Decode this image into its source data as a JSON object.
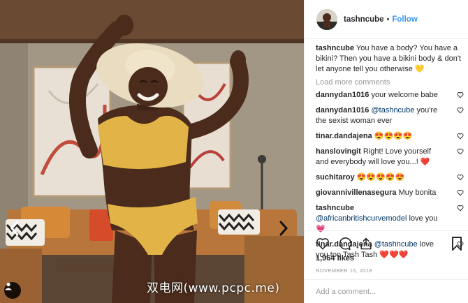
{
  "post": {
    "image_alt": "Woman in a yellow bikini and straw hat dancing in a living room",
    "watermark": "双电网(www.pcpc.me)",
    "icons": {
      "prev": "chevron-left-icon",
      "next": "chevron-right-icon",
      "tag": "user-tag-icon"
    }
  },
  "header": {
    "username": "tashncube",
    "dot": "•",
    "follow_label": "Follow"
  },
  "caption": {
    "username": "tashncube",
    "text": "You have a body? You have a bikini? Then you have a bikini body & don't let anyone tell you otherwise 💛"
  },
  "load_more": "Load more comments",
  "comments": [
    {
      "user": "dannydan1016",
      "text": "your welcome babe",
      "mention": ""
    },
    {
      "user": "dannydan1016",
      "mention": "@tashncube",
      "text": "you're the sexist woman ever"
    },
    {
      "user": "tinar.dandajena",
      "text": "😍😍😍😍",
      "mention": ""
    },
    {
      "user": "hanslovingit",
      "text": "Right! Love yourself and everybody will love you...! ❤️",
      "mention": ""
    },
    {
      "user": "suchitaroy",
      "text": "😍😍😍😍😍",
      "mention": ""
    },
    {
      "user": "giovannivillenasegura",
      "text": "Muy bonita",
      "mention": ""
    },
    {
      "user": "tashncube",
      "mention": "@africanbritishcurvemodel",
      "text": "love you 💗"
    },
    {
      "user": "tinar.dandajena",
      "mention": "@tashncube",
      "text": "love you too Tash Tash ❤️❤️❤️"
    }
  ],
  "actions": {
    "likes": "1,964 likes",
    "date": "NOVEMBER 15, 2018",
    "icons": [
      "heart-icon",
      "comment-icon",
      "share-icon",
      "bookmark-icon"
    ]
  },
  "add_comment": {
    "placeholder": "Add a comment..."
  },
  "colors": {
    "link": "#3897f0",
    "mention": "#003569",
    "muted": "#999999",
    "text": "#262626",
    "border": "#efefef"
  }
}
